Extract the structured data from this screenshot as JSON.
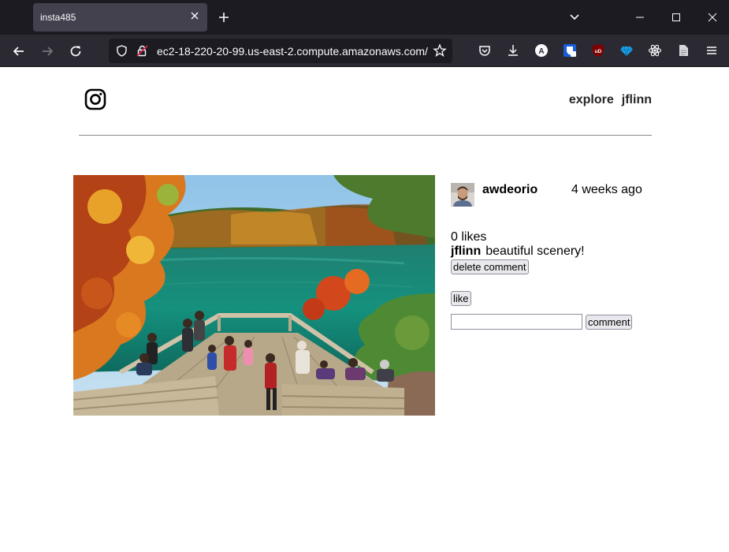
{
  "browser": {
    "tab_title": "insta485",
    "url": "ec2-18-220-20-99.us-east-2.compute.amazonaws.com/"
  },
  "header": {
    "logo_icon": "instagram-icon",
    "nav": {
      "explore_label": "explore",
      "user_label": "jflinn"
    }
  },
  "post": {
    "image": "autumn-lake-overlook-photo",
    "owner": "awdeorio",
    "owner_avatar": "owner-avatar-photo",
    "timestamp": "4 weeks ago",
    "likes_text": "0 likes",
    "comments": [
      {
        "owner": "jflinn",
        "text": "beautiful scenery!"
      }
    ],
    "delete_comment_label": "delete comment",
    "like_label": "like",
    "comment_input_value": "",
    "comment_button_label": "comment"
  },
  "colors": {
    "chrome_tabbar": "#1c1b22",
    "chrome_toolbar": "#2b2a33",
    "nav_text": "#262626"
  }
}
